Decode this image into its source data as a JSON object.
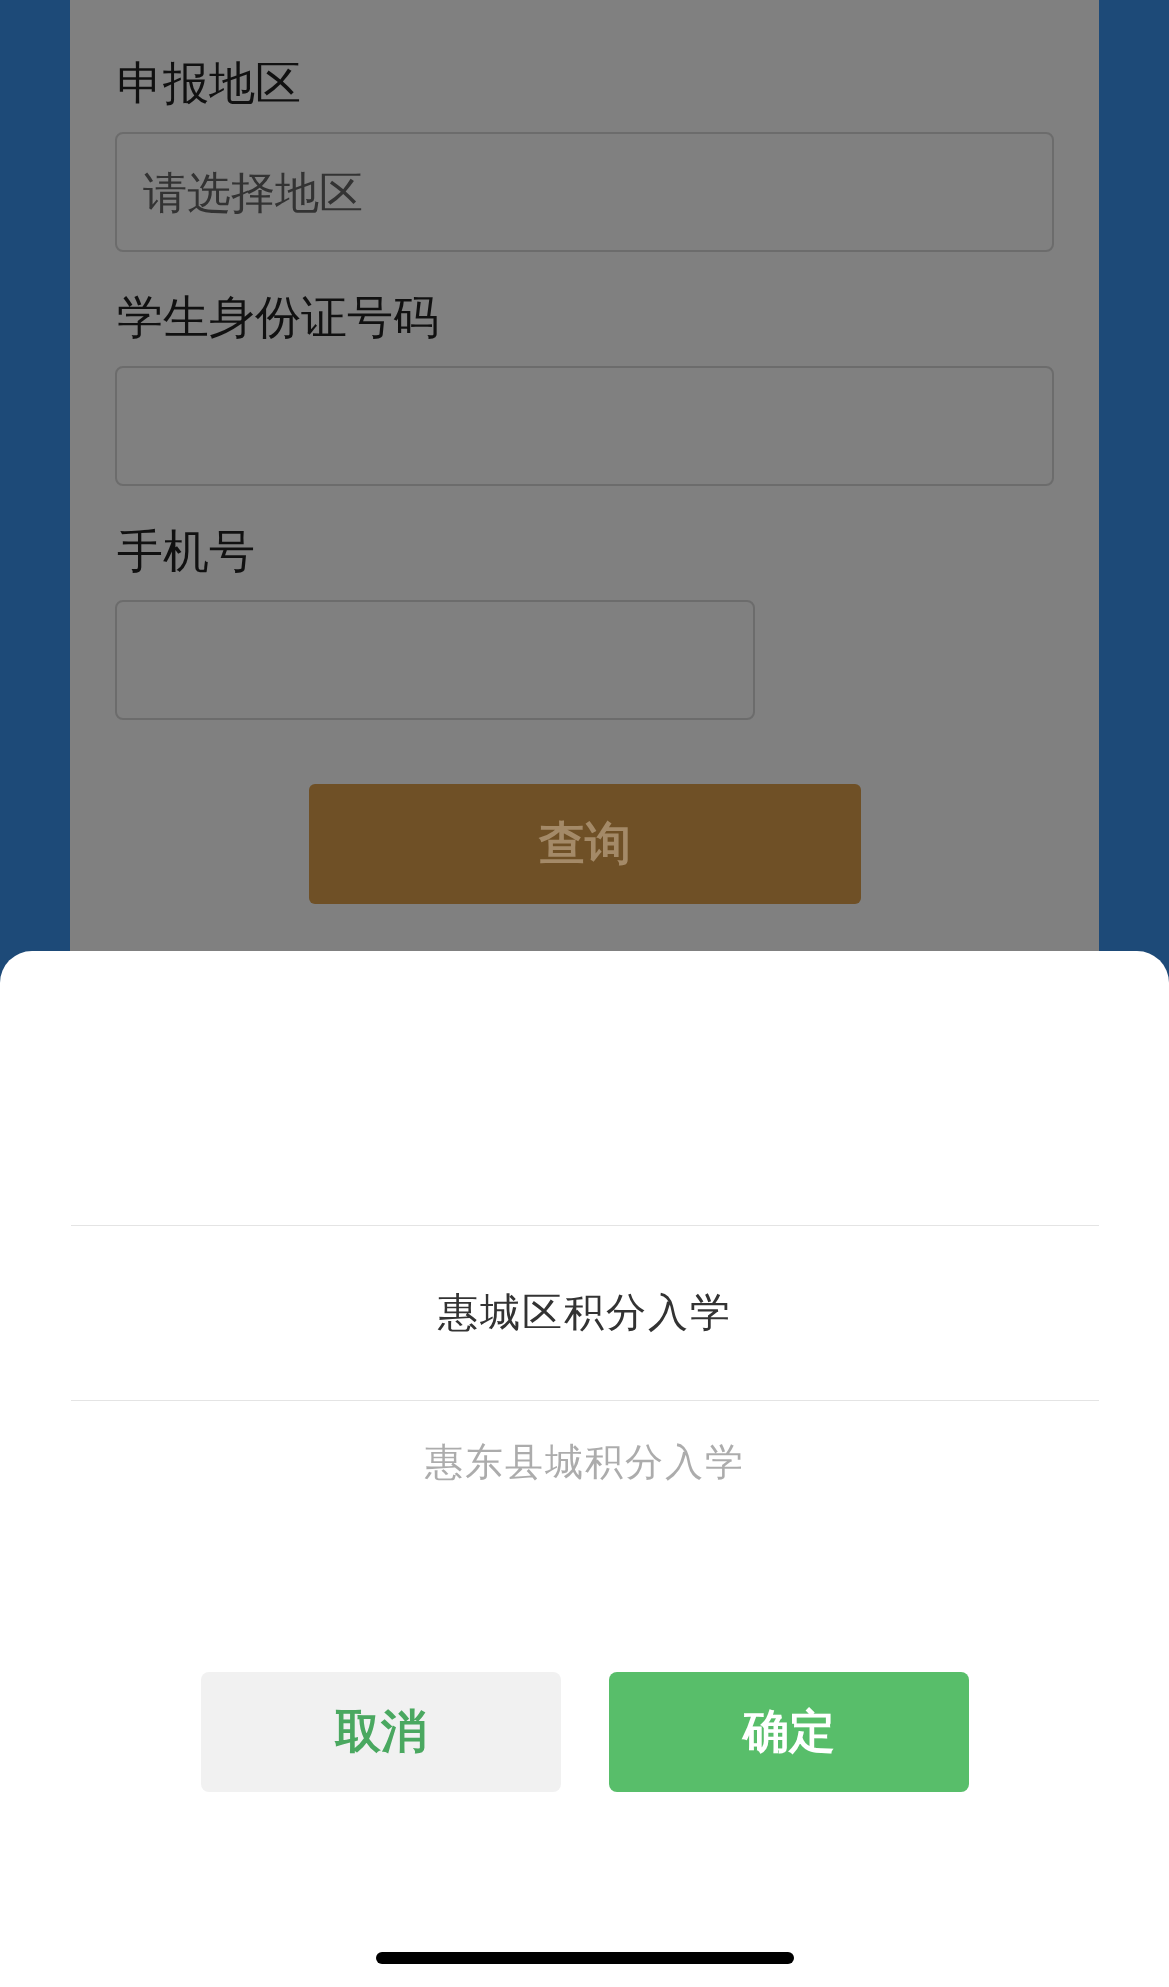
{
  "form": {
    "fields": [
      {
        "label": "申报地区",
        "placeholder": "请选择地区",
        "wide": true
      },
      {
        "label": "学生身份证号码",
        "wide": true
      },
      {
        "label": "手机号",
        "wide": false
      }
    ],
    "submit_button": "查询"
  },
  "picker": {
    "items": [
      {
        "label": "惠城区积分入学",
        "selected": true
      },
      {
        "label": "惠东县城积分入学",
        "selected": false
      }
    ],
    "cancel_button": "取消",
    "confirm_button": "确定"
  }
}
